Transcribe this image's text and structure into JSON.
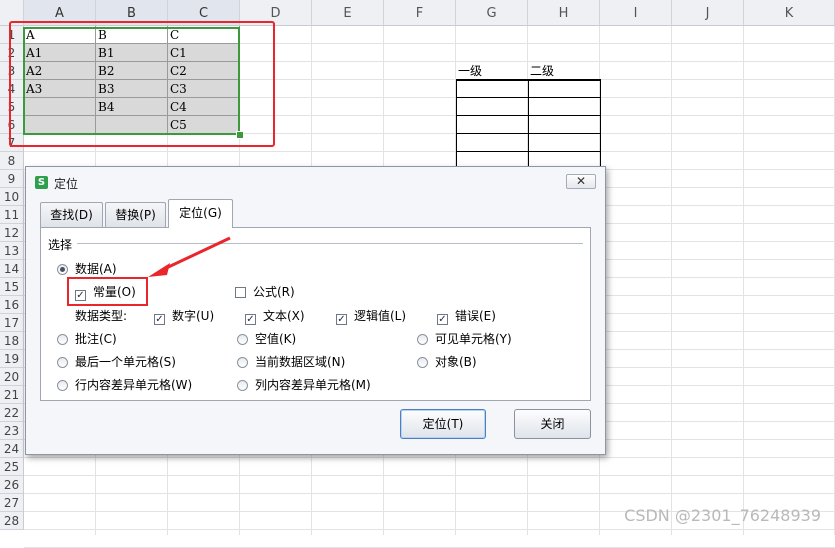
{
  "columns": [
    "A",
    "B",
    "C",
    "D",
    "E",
    "F",
    "G",
    "H",
    "I",
    "J",
    "K"
  ],
  "selected_columns": [
    "A",
    "B",
    "C"
  ],
  "rows": [
    "1",
    "2",
    "3",
    "4",
    "5",
    "6",
    "7",
    "8",
    "9",
    "10",
    "11",
    "12",
    "13",
    "14",
    "15",
    "16",
    "17",
    "18",
    "19",
    "20",
    "21",
    "22",
    "23",
    "24",
    "25",
    "26",
    "27",
    "28"
  ],
  "cells": {
    "A1": "A",
    "B1": "B",
    "C1": "C",
    "A2": "A1",
    "B2": "B1",
    "C2": "C1",
    "A3": "A2",
    "B3": "B2",
    "C3": "C2",
    "A4": "A3",
    "B4": "B3",
    "C4": "C3",
    "A5": "",
    "B5": "B4",
    "C5": "C4",
    "A6": "",
    "B6": "",
    "C6": "C5"
  },
  "right_table": {
    "headers": [
      "一级",
      "二级"
    ]
  },
  "dialog": {
    "title": "定位",
    "app_icon": "S",
    "close_glyph": "✕",
    "tabs": [
      {
        "label": "查找(D)",
        "active": false
      },
      {
        "label": "替换(P)",
        "active": false
      },
      {
        "label": "定位(G)",
        "active": true
      }
    ],
    "section_label": "选择",
    "options": {
      "data": {
        "label": "数据(A)",
        "selected": true
      },
      "constant": {
        "label": "常量(O)",
        "checked": true
      },
      "formula": {
        "label": "公式(R)",
        "checked": false
      },
      "data_type_label": "数据类型:",
      "number": {
        "label": "数字(U)",
        "checked": true
      },
      "text": {
        "label": "文本(X)",
        "checked": true
      },
      "logical": {
        "label": "逻辑值(L)",
        "checked": true
      },
      "error": {
        "label": "错误(E)",
        "checked": true
      },
      "comment": {
        "label": "批注(C)",
        "selected": false
      },
      "blank": {
        "label": "空值(K)",
        "selected": false
      },
      "visible": {
        "label": "可见单元格(Y)",
        "selected": false
      },
      "last_cell": {
        "label": "最后一个单元格(S)",
        "selected": false
      },
      "current_region": {
        "label": "当前数据区域(N)",
        "selected": false
      },
      "objects": {
        "label": "对象(B)",
        "selected": false
      },
      "row_diff": {
        "label": "行内容差异单元格(W)",
        "selected": false
      },
      "col_diff": {
        "label": "列内容差异单元格(M)",
        "selected": false
      }
    },
    "buttons": {
      "goto": "定位(T)",
      "close": "关闭"
    }
  },
  "watermark": "CSDN @2301_76248939",
  "colors": {
    "annotation_red": "#e8262c",
    "selection_green": "#3c9a3c",
    "cell_gray": "#d9d9d9"
  }
}
